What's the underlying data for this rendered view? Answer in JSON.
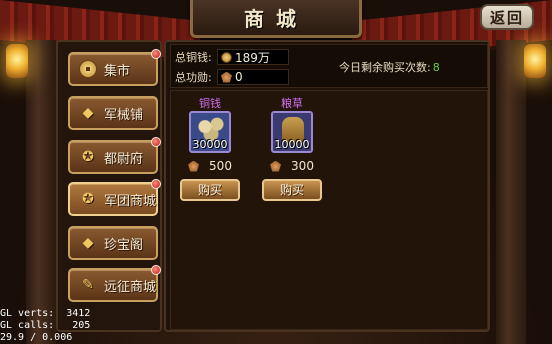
{
  "header": {
    "title": "商城",
    "back_label": "返回"
  },
  "sidebar": {
    "items": [
      {
        "label": "集市",
        "icon": "coin-icon",
        "badge": true,
        "active": false
      },
      {
        "label": "军械铺",
        "icon": "ingot-icon",
        "badge": false,
        "active": false
      },
      {
        "label": "都尉府",
        "icon": "emblem-icon",
        "badge": true,
        "active": false
      },
      {
        "label": "军团商城",
        "icon": "emblem-icon",
        "badge": true,
        "active": true
      },
      {
        "label": "珍宝阁",
        "icon": "ingot-icon",
        "badge": false,
        "active": false
      },
      {
        "label": "远征商城",
        "icon": "scroll-icon",
        "badge": true,
        "active": false
      }
    ]
  },
  "stats": {
    "copper_label": "总铜钱:",
    "copper_value": "189万",
    "merit_label": "总功勋:",
    "merit_value": "0",
    "remaining_label": "今日剩余购买次数:",
    "remaining_value": "8"
  },
  "items": [
    {
      "name": "铜钱",
      "quantity": "30000",
      "price": "500",
      "buy_label": "购买"
    },
    {
      "name": "粮草",
      "quantity": "10000",
      "price": "300",
      "buy_label": "购买"
    }
  ],
  "debug": {
    "line1": "GL verts:  3412",
    "line2": "GL calls:   205",
    "line3": "29.9 / 0.006"
  },
  "colors": {
    "accent_gold": "#c8a060",
    "item_name_purple": "#d070f0",
    "remaining_green": "#6ad040",
    "badge_red": "#c01818"
  }
}
